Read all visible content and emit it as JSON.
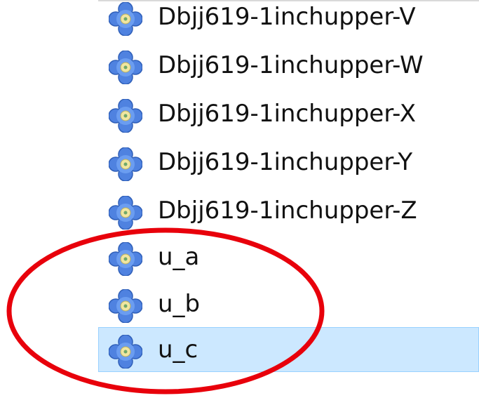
{
  "file_list": {
    "items": [
      {
        "label": "Dbjj619-1inchupper-V",
        "icon": "font-file-icon",
        "selected": false
      },
      {
        "label": "Dbjj619-1inchupper-W",
        "icon": "font-file-icon",
        "selected": false
      },
      {
        "label": "Dbjj619-1inchupper-X",
        "icon": "font-file-icon",
        "selected": false
      },
      {
        "label": "Dbjj619-1inchupper-Y",
        "icon": "font-file-icon",
        "selected": false
      },
      {
        "label": "Dbjj619-1inchupper-Z",
        "icon": "font-file-icon",
        "selected": false
      },
      {
        "label": "u_a",
        "icon": "font-file-icon",
        "selected": false
      },
      {
        "label": "u_b",
        "icon": "font-file-icon",
        "selected": false
      },
      {
        "label": "u_c",
        "icon": "font-file-icon",
        "selected": true
      }
    ]
  },
  "annotation": {
    "shape": "ellipse",
    "color": "#e8000b",
    "highlights": [
      "u_a",
      "u_b",
      "u_c"
    ]
  },
  "colors": {
    "selection_background": "#cce8ff",
    "selection_border": "#99d1ff",
    "icon_petal": "#5b8fe8",
    "icon_center": "#f0e6a0"
  }
}
